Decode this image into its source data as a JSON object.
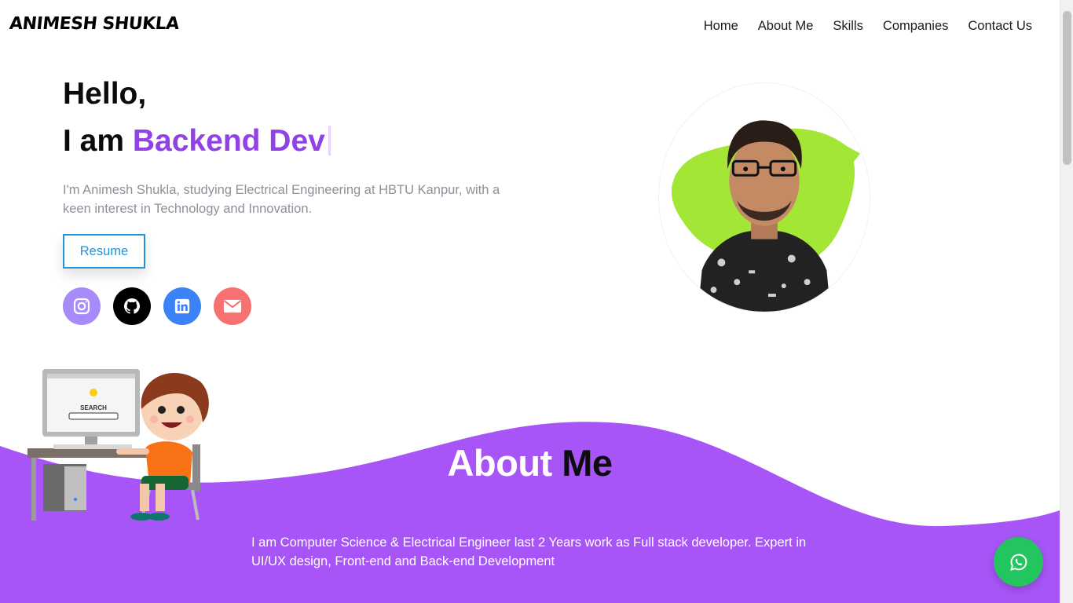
{
  "header": {
    "logo": "ANIMESH SHUKLA",
    "nav": [
      "Home",
      "About Me",
      "Skills",
      "Companies",
      "Contact Us"
    ]
  },
  "hero": {
    "greeting": "Hello,",
    "iam": "I am",
    "role": "Backend Dev",
    "intro": "I'm Animesh Shukla, studying Electrical Engineering at HBTU Kanpur, with a keen interest in Technology and Innovation.",
    "resume_label": "Resume"
  },
  "socials": [
    {
      "icon": "instagram-icon",
      "color": "#a78bfa"
    },
    {
      "icon": "github-icon",
      "color": "#000000"
    },
    {
      "icon": "linkedin-icon",
      "color": "#3b82f6"
    },
    {
      "icon": "mail-icon",
      "color": "#f87171"
    }
  ],
  "illustration": {
    "search_text": "SEARCH"
  },
  "about": {
    "title_part1": "About",
    "title_part2": "Me",
    "text": "I am Computer Science & Electrical Engineer last 2 Years work as Full stack developer. Expert in UI/UX design, Front-end and Back-end Development"
  },
  "colors": {
    "accent": "#9241e6",
    "wave": "#a855f7",
    "button_border": "#2593d6",
    "whatsapp": "#22c55e"
  },
  "floating": {
    "icon": "whatsapp-icon"
  }
}
